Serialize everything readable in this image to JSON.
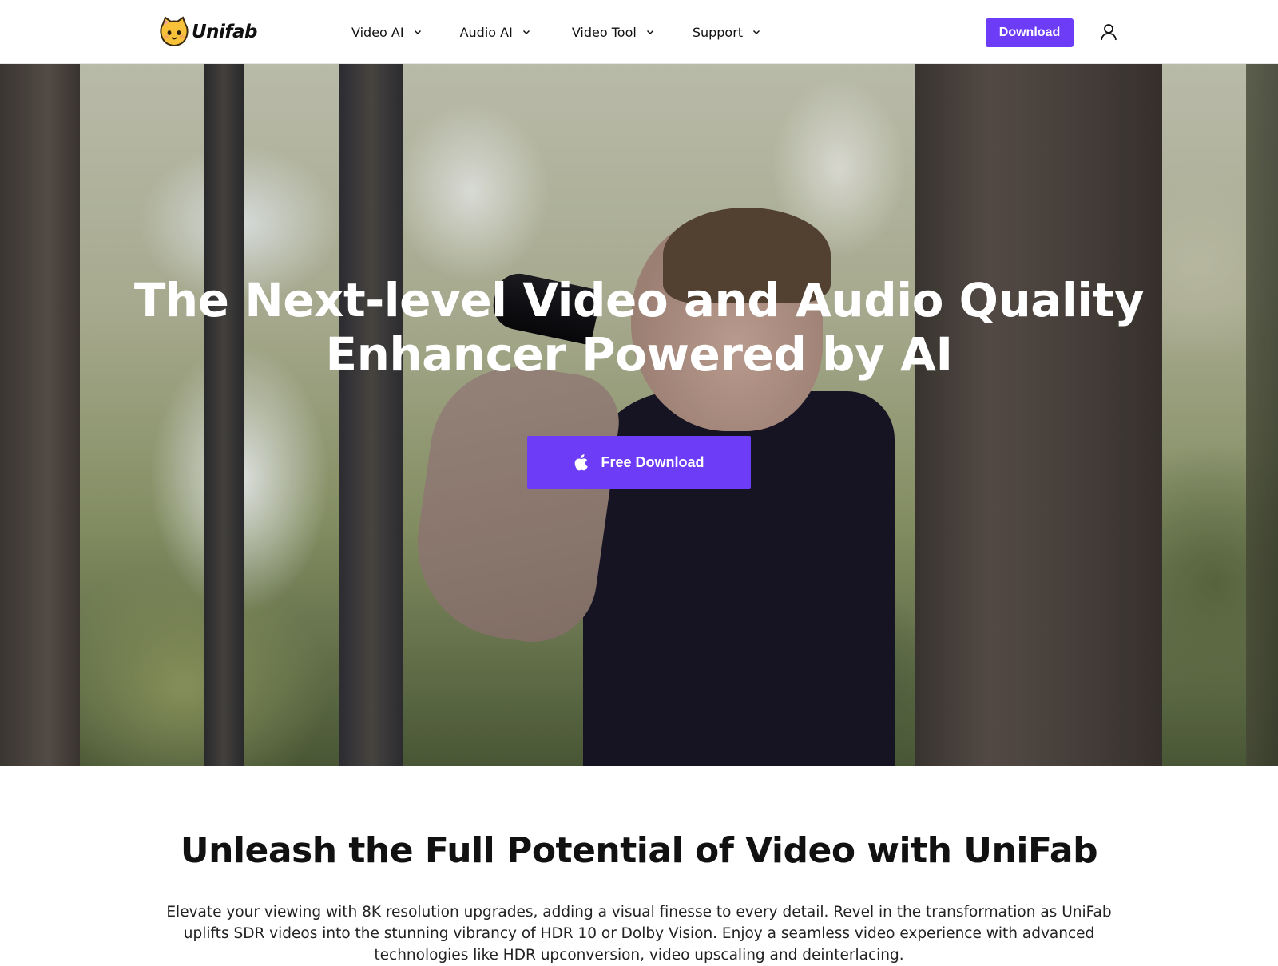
{
  "header": {
    "logo_text": "Unifab",
    "nav": [
      {
        "label": "Video AI",
        "icon": "chevron-down-icon"
      },
      {
        "label": "Audio AI",
        "icon": "chevron-down-icon"
      },
      {
        "label": "Video Tool",
        "icon": "chevron-down-icon"
      },
      {
        "label": "Support",
        "icon": "chevron-down-icon"
      }
    ],
    "download_label": "Download",
    "user_icon": "user-icon"
  },
  "hero": {
    "title_line1": "The Next-level Video and Audio Quality",
    "title_line2": "Enhancer Powered by AI",
    "cta_label": "Free Download",
    "cta_icon": "apple-icon"
  },
  "intro": {
    "title": "Unleash the Full Potential of Video with UniFab",
    "text": "Elevate your viewing with 8K resolution upgrades, adding a visual finesse to every detail. Revel in the transformation as UniFab uplifts SDR videos into the stunning vibrancy of HDR 10 or Dolby Vision. Enjoy a seamless video experience with advanced technologies like HDR upconversion, video upscaling and deinterlacing."
  },
  "colors": {
    "accent": "#6c3cf7",
    "text": "#111111",
    "background": "#ffffff"
  }
}
